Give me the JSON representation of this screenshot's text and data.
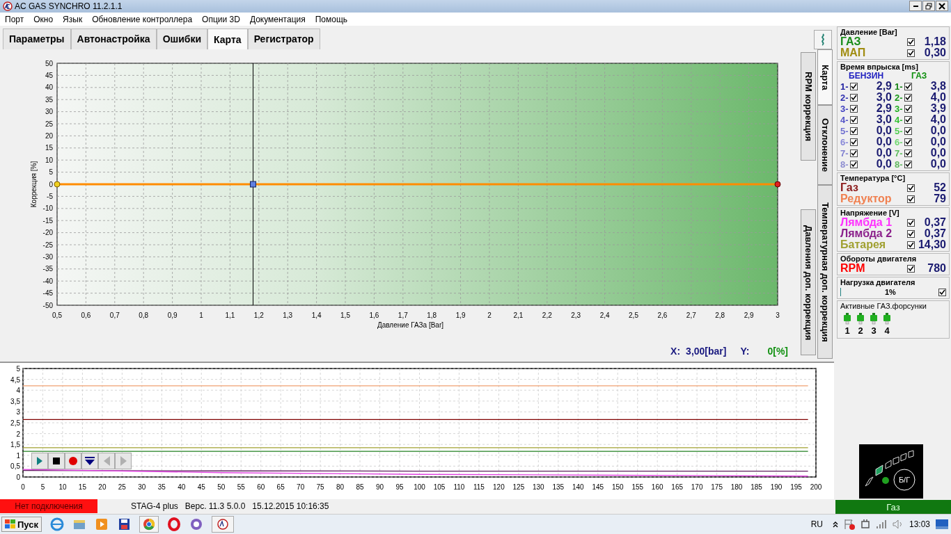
{
  "window": {
    "title": "AC GAS SYNCHRO  11.2.1.1"
  },
  "menu": [
    "Порт",
    "Окно",
    "Язык",
    "Обновление контроллера",
    "Опции 3D",
    "Документация",
    "Помощь"
  ],
  "tabs": [
    {
      "label": "Параметры",
      "selected": false
    },
    {
      "label": "Автонастройка",
      "selected": false
    },
    {
      "label": "Ошибки",
      "selected": false
    },
    {
      "label": "Карта",
      "selected": true
    },
    {
      "label": "Регистратор",
      "selected": false
    }
  ],
  "vertical_tabs": {
    "outer": [
      {
        "label": "RPM коррекция",
        "selected": false
      },
      {
        "label": "Давления доп. коррекция",
        "selected": false
      }
    ],
    "inner": [
      {
        "label": "Карта",
        "selected": true
      },
      {
        "label": "Отклонение",
        "selected": false
      },
      {
        "label": "Температурная доп. коррекция",
        "selected": false
      }
    ]
  },
  "main_chart": {
    "chart_data": {
      "type": "line",
      "xlabel": "Давление ГАЗа [Bar]",
      "ylabel": "Коррекция [%]",
      "x": [
        0.5,
        1.18,
        3
      ],
      "series": [
        {
          "color": "#ff8c00",
          "values": [
            0,
            0,
            0
          ],
          "marker": true
        }
      ],
      "grid": true,
      "xlim": [
        0.5,
        3
      ],
      "ylim": [
        -50,
        50
      ],
      "xticks": [
        {
          "value": 0.5,
          "label": "0,5"
        },
        {
          "value": 0.6,
          "label": "0,6"
        },
        {
          "value": 0.7,
          "label": "0,7"
        },
        {
          "value": 0.8,
          "label": "0,8"
        },
        {
          "value": 0.9,
          "label": "0,9"
        },
        {
          "value": 1,
          "label": "1"
        },
        {
          "value": 1.1,
          "label": "1,1"
        },
        {
          "value": 1.2,
          "label": "1,2"
        },
        {
          "value": 1.3,
          "label": "1,3"
        },
        {
          "value": 1.4,
          "label": "1,4"
        },
        {
          "value": 1.5,
          "label": "1,5"
        },
        {
          "value": 1.6,
          "label": "1,6"
        },
        {
          "value": 1.7,
          "label": "1,7"
        },
        {
          "value": 1.8,
          "label": "1,8"
        },
        {
          "value": 1.9,
          "label": "1,9"
        },
        {
          "value": 2,
          "label": "2"
        },
        {
          "value": 2.1,
          "label": "2,1"
        },
        {
          "value": 2.2,
          "label": "2,2"
        },
        {
          "value": 2.3,
          "label": "2,3"
        },
        {
          "value": 2.4,
          "label": "2,4"
        },
        {
          "value": 2.5,
          "label": "2,5"
        },
        {
          "value": 2.6,
          "label": "2,6"
        },
        {
          "value": 2.7,
          "label": "2,7"
        },
        {
          "value": 2.8,
          "label": "2,8"
        },
        {
          "value": 2.9,
          "label": "2,9"
        },
        {
          "value": 3,
          "label": "3"
        }
      ],
      "yticks": [
        -50,
        -45,
        -40,
        -35,
        -30,
        -25,
        -20,
        -15,
        -10,
        -5,
        0,
        5,
        10,
        15,
        20,
        25,
        30,
        35,
        40,
        45,
        50
      ],
      "ref_lines": [
        {
          "axis": "x",
          "value": 1.18
        }
      ]
    },
    "readout": {
      "x_label": "X:",
      "x_value": "3,00[bar]",
      "y_label": "Y:",
      "y_value": "0[%]"
    }
  },
  "log_chart": {
    "chart_data": {
      "type": "line",
      "grid": true,
      "x": [
        0,
        50,
        100,
        150,
        198
      ],
      "series": [
        {
          "color": "#f0a070",
          "values": [
            4.2,
            4.2,
            4.2,
            4.2,
            4.2
          ]
        },
        {
          "color": "#800000",
          "values": [
            2.65,
            2.65,
            2.65,
            2.65,
            2.65
          ]
        },
        {
          "color": "#a0a030",
          "values": [
            1.35,
            1.35,
            1.35,
            1.35,
            1.35
          ]
        },
        {
          "color": "#208020",
          "values": [
            1.18,
            1.18,
            1.18,
            1.18,
            1.18
          ]
        },
        {
          "color": "#602060",
          "values": [
            0.3,
            0.28,
            0.27,
            0.27,
            0.27
          ]
        },
        {
          "color": "#e040e0",
          "values": [
            0.35,
            0.2,
            0.12,
            0.08,
            0.04
          ]
        }
      ],
      "xlim": [
        0,
        200
      ],
      "ylim": [
        0,
        5
      ],
      "xticks": [
        0,
        5,
        10,
        15,
        20,
        25,
        30,
        35,
        40,
        45,
        50,
        55,
        60,
        65,
        70,
        75,
        80,
        85,
        90,
        95,
        100,
        105,
        110,
        115,
        120,
        125,
        130,
        135,
        140,
        145,
        150,
        155,
        160,
        165,
        170,
        175,
        180,
        185,
        190,
        195,
        200
      ],
      "yticks": [
        {
          "value": 0,
          "label": "0"
        },
        {
          "value": 0.5,
          "label": "0,5"
        },
        {
          "value": 1,
          "label": "1"
        },
        {
          "value": 1.5,
          "label": "1,5"
        },
        {
          "value": 2,
          "label": "2"
        },
        {
          "value": 2.5,
          "label": "2,5"
        },
        {
          "value": 3,
          "label": "3"
        },
        {
          "value": 3.5,
          "label": "3,5"
        },
        {
          "value": 4,
          "label": "4"
        },
        {
          "value": 4.5,
          "label": "4,5"
        },
        {
          "value": 5,
          "label": "5"
        }
      ]
    }
  },
  "pressure": {
    "title": "Давление [Bar]",
    "rows": [
      {
        "label": "ГАЗ",
        "color": "#1a8c1a",
        "checked": true,
        "value": "1,18"
      },
      {
        "label": "МАП",
        "color": "#a08c10",
        "checked": true,
        "value": "0,30"
      }
    ]
  },
  "injection": {
    "title": "Время впрыска [ms]",
    "petrol_heading": "БЕНЗИН",
    "gas_heading": "ГАЗ",
    "petrol": [
      {
        "label": "1-",
        "color": "#2020a0",
        "checked": true,
        "value": "2,9"
      },
      {
        "label": "2-",
        "color": "#3030b0",
        "checked": true,
        "value": "3,0"
      },
      {
        "label": "3-",
        "color": "#4040c0",
        "checked": true,
        "value": "2,9"
      },
      {
        "label": "4-",
        "color": "#5555c8",
        "checked": true,
        "value": "3,0"
      },
      {
        "label": "5-",
        "color": "#7070d0",
        "checked": true,
        "value": "0,0"
      },
      {
        "label": "6-",
        "color": "#8888d8",
        "checked": true,
        "value": "0,0"
      },
      {
        "label": "7-",
        "color": "#8080d0",
        "checked": true,
        "value": "0,0"
      },
      {
        "label": "8-",
        "color": "#8c8cd0",
        "checked": true,
        "value": "0,0"
      }
    ],
    "gas": [
      {
        "label": "1-",
        "color": "#108010",
        "checked": true,
        "value": "3,8"
      },
      {
        "label": "2-",
        "color": "#189818",
        "checked": true,
        "value": "4,0"
      },
      {
        "label": "3-",
        "color": "#20b020",
        "checked": true,
        "value": "3,9"
      },
      {
        "label": "4-",
        "color": "#30c030",
        "checked": true,
        "value": "4,0"
      },
      {
        "label": "5-",
        "color": "#50cc50",
        "checked": true,
        "value": "0,0"
      },
      {
        "label": "6-",
        "color": "#70d870",
        "checked": true,
        "value": "0,0"
      },
      {
        "label": "7-",
        "color": "#5cbc5c",
        "checked": true,
        "value": "0,0"
      },
      {
        "label": "8-",
        "color": "#60b860",
        "checked": true,
        "value": "0,0"
      }
    ]
  },
  "temperature": {
    "title": "Температура  [°C]",
    "rows": [
      {
        "label": "Газ",
        "color": "#8b1a1a",
        "checked": true,
        "value": "52"
      },
      {
        "label": "Редуктор",
        "color": "#f08050",
        "checked": true,
        "value": "79"
      }
    ]
  },
  "voltage": {
    "title": "Напряжение [V]",
    "rows": [
      {
        "label": "Лямбда 1",
        "color": "#ff30ff",
        "checked": true,
        "value": "0,37"
      },
      {
        "label": "Лямбда 2",
        "color": "#8b208b",
        "checked": true,
        "value": "0,37"
      },
      {
        "label": "Батарея",
        "color": "#a0a030",
        "checked": true,
        "value": "14,30"
      }
    ]
  },
  "rpm": {
    "title": "Обороты двигателя",
    "rows": [
      {
        "label": "RPM",
        "color": "#ff0000",
        "checked": true,
        "value": "780"
      }
    ]
  },
  "load": {
    "title": "Нагрузка двигателя",
    "value": "1%",
    "level": 0.01,
    "checked": true
  },
  "injectors": {
    "title": "Активные ГАЗ.форсунки",
    "items": [
      {
        "label": "1",
        "active": true
      },
      {
        "label": "2",
        "active": true
      },
      {
        "label": "3",
        "active": true
      },
      {
        "label": "4",
        "active": true
      }
    ]
  },
  "switch": {
    "button": "Б/Г",
    "fuel": "Газ"
  },
  "status_bar": {
    "connection": "Нет подключения",
    "device": "STAG-4 plus",
    "version": "Верс. 11.3  5.0.0",
    "datetime": "15.12.2015 10:16:35"
  },
  "taskbar": {
    "start": "Пуск",
    "language": "RU",
    "clock": "13:03"
  }
}
